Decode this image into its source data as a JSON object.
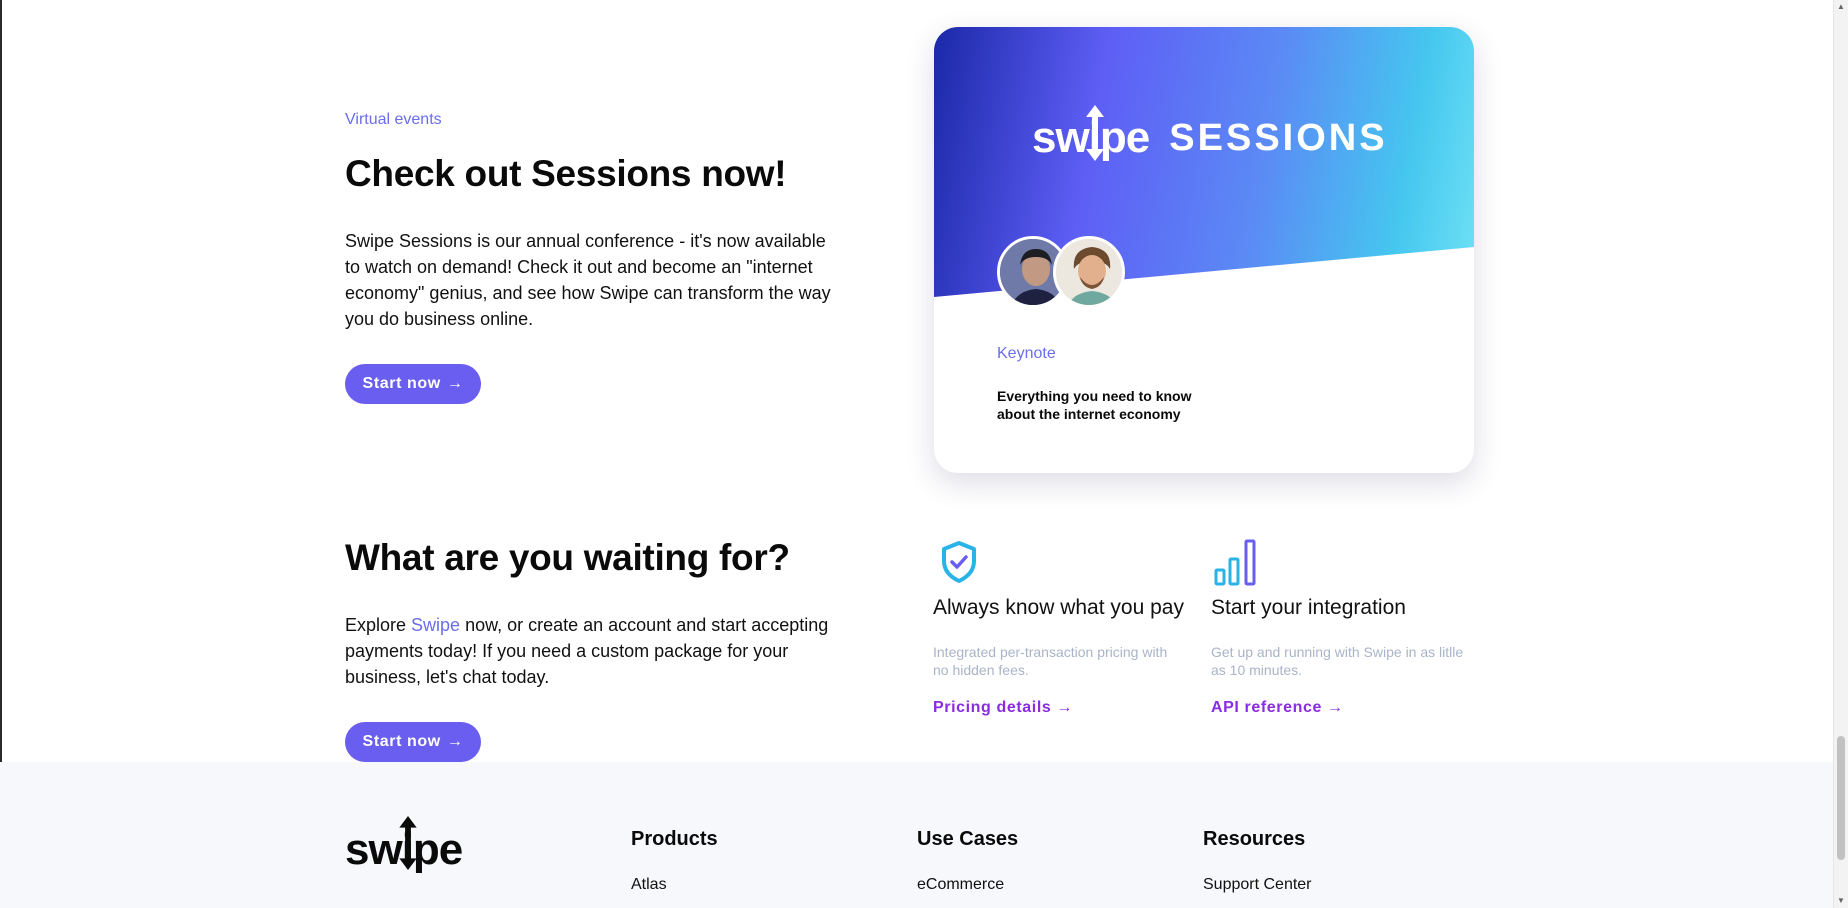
{
  "sessions": {
    "eyebrow": "Virtual events",
    "title": "Check out Sessions now!",
    "description": "Swipe Sessions is our annual conference - it's now available to watch on demand! Check it out and become an \"internet economy\" genius, and see how Swipe can transform the way you do business online.",
    "button_label": "Start now"
  },
  "card": {
    "logo_text": "swipe",
    "logo_suffix": "SESSIONS",
    "tag": "Keynote",
    "headline": "Everything you need to know about the internet economy"
  },
  "waiting": {
    "title": "What are you waiting for?",
    "text_before": "Explore ",
    "link_text": "Swipe",
    "text_after": " now, or create an account and start accepting payments today! If you need a custom package for your business, let's chat today.",
    "button_label": "Start now"
  },
  "features": [
    {
      "icon": "shield-check-icon",
      "title": "Always know what you pay",
      "description": "Integrated per-transaction pricing with no hidden fees.",
      "link": "Pricing details"
    },
    {
      "icon": "bar-chart-icon",
      "title": "Start your integration",
      "description": "Get up and running with Swipe in as litlle as 10 minutes.",
      "link": "API reference"
    }
  ],
  "footer": {
    "logo_text": "swipe",
    "columns": [
      {
        "heading": "Products",
        "items": [
          "Atlas"
        ]
      },
      {
        "heading": "Use Cases",
        "items": [
          "eCommerce"
        ]
      },
      {
        "heading": "Resources",
        "items": [
          "Support Center"
        ]
      }
    ]
  },
  "colors": {
    "accent": "#6a5ef0",
    "link": "#8a2ce0",
    "eyebrow": "#6b6ee9",
    "muted": "#a9b4c8"
  }
}
